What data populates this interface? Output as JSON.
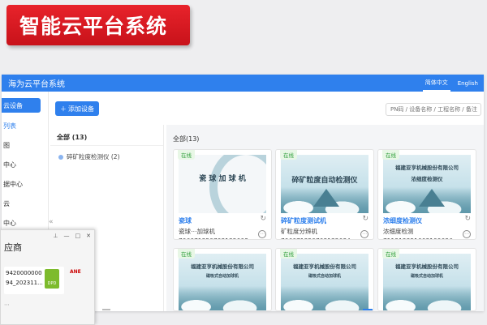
{
  "banner": {
    "title": "智能云平台系统"
  },
  "app": {
    "title": "海为云平台系统",
    "langs": [
      "简体中文",
      "English"
    ]
  },
  "nav": {
    "items": [
      "云设备",
      "列表",
      "图",
      "中心",
      "据中心",
      "云",
      "中心"
    ]
  },
  "toolbar": {
    "add_label": "添加设备"
  },
  "search": {
    "placeholder": "PN码 / 设备名称 / 工程名称 / 备注"
  },
  "tree": {
    "all_label": "全部 (13)",
    "nodes": [
      "碎矿粒度检测仪 (2)"
    ]
  },
  "grid": {
    "header": "全部(13)",
    "cards": [
      {
        "status": "在线",
        "thumb_text": "瓷 球 加 球 机",
        "name": "瓷球",
        "model": "瓷球⋯加球机",
        "sn": "706071350703132008"
      },
      {
        "status": "在线",
        "thumb_text": "碎矿粒度自动检测仪",
        "name": "碎矿粒度测试机",
        "model": "矿粒度分辨机",
        "sn": "706071350703132084"
      },
      {
        "status": "在线",
        "thumb_text": "福建亚亨机械股份有限公司",
        "thumb_sub": "浓细度检测仪",
        "name": "浓细度检测仪",
        "model": "浓细度检测",
        "sn": "711212351003199026"
      },
      {
        "status": "在线",
        "thumb_text": "福建亚亨机械股份有限公司",
        "thumb_sub": "磁吸式自动加球机"
      },
      {
        "status": "在线",
        "thumb_text": "福建亚亨机械股份有限公司",
        "thumb_sub": "磁吸式自动加球机"
      },
      {
        "status": "在线",
        "thumb_text": "福建亚亨机械股份有限公司",
        "thumb_sub": "磁吸式自动加球机"
      }
    ]
  },
  "overlay": {
    "title": "应商",
    "file_line1": "9420000000",
    "file_line2": "94_202311...",
    "doc_label": "DPD",
    "logo": "ANE"
  },
  "colors": {
    "accent": "#2f80ed",
    "banner": "#d91a22",
    "online": "#2e9e3a"
  }
}
